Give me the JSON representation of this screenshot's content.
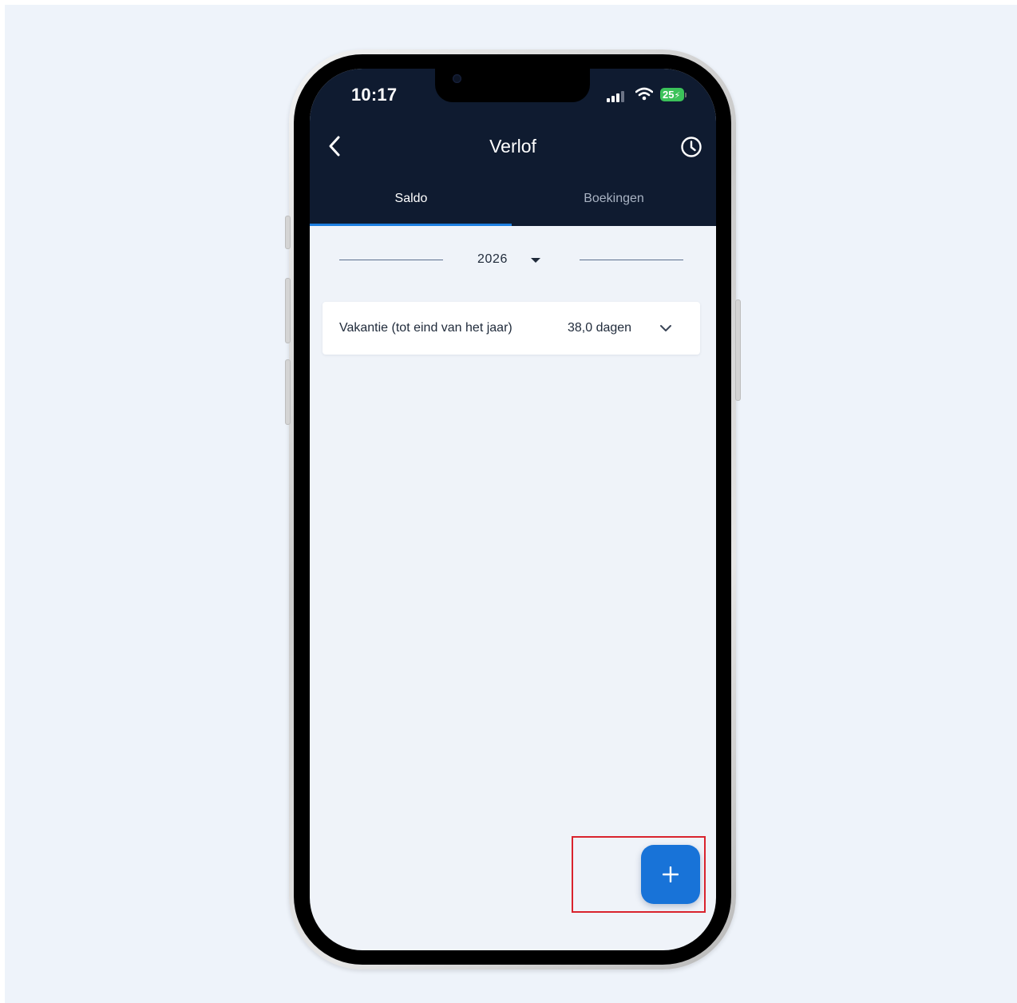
{
  "status_bar": {
    "time": "10:17",
    "battery": "25",
    "icons": [
      "signal-icon",
      "wifi-icon",
      "battery-icon"
    ]
  },
  "header": {
    "title": "Verlof",
    "back_icon": "chevron-left-icon",
    "history_icon": "clock-icon"
  },
  "tabs": [
    {
      "label": "Saldo",
      "active": true
    },
    {
      "label": "Boekingen",
      "active": false
    }
  ],
  "year_selector": {
    "value": "2026",
    "icon": "caret-down-icon"
  },
  "balances": [
    {
      "label": "Vakantie (tot eind van het jaar)",
      "value": "38,0 dagen",
      "icon": "chevron-down-icon"
    }
  ],
  "fab": {
    "icon": "plus-icon"
  },
  "colors": {
    "header_bg": "#0f1b30",
    "accent": "#1873d8",
    "tab_indicator": "#1e7fe0",
    "screen_bg": "#eff3f9",
    "highlight": "#d9232d"
  }
}
